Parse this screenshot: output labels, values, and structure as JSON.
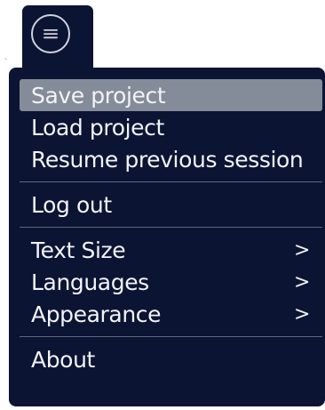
{
  "menu_button": {
    "icon": "hamburger-icon"
  },
  "menu": {
    "groups": [
      [
        {
          "label": "Save project",
          "highlighted": true
        },
        {
          "label": "Load project"
        },
        {
          "label": "Resume previous session"
        }
      ],
      [
        {
          "label": "Log out"
        }
      ],
      [
        {
          "label": "Text Size",
          "submenu": ">"
        },
        {
          "label": "Languages",
          "submenu": ">"
        },
        {
          "label": "Appearance",
          "submenu": ">"
        }
      ],
      [
        {
          "label": "About"
        }
      ]
    ]
  },
  "colors": {
    "panel_bg": "#0b1433",
    "highlight": "#858c99",
    "text": "#f2f3f6",
    "divider": "#5f6677"
  }
}
